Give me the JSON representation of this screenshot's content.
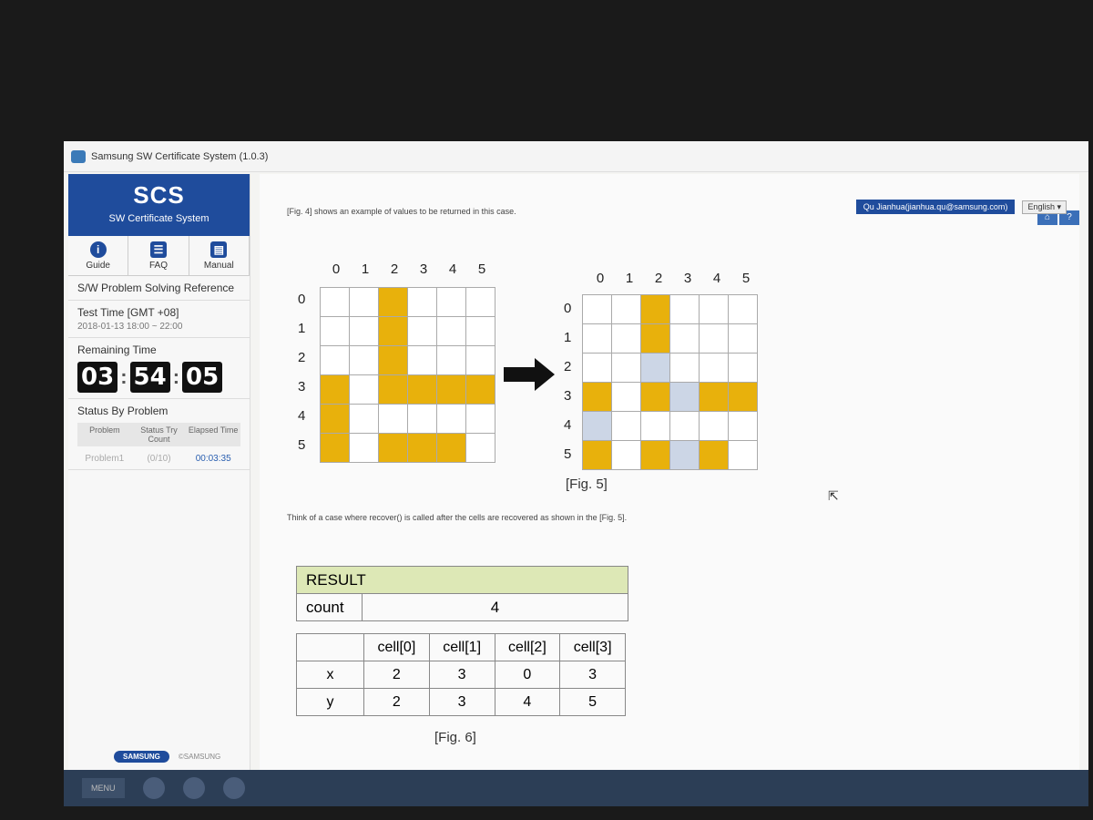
{
  "window": {
    "title": "Samsung SW Certificate System (1.0.3)"
  },
  "brand": {
    "name": "SCS",
    "subtitle": "SW Certificate System"
  },
  "iconbar": [
    {
      "label": "Guide",
      "icon": "info-icon"
    },
    {
      "label": "FAQ",
      "icon": "faq-icon"
    },
    {
      "label": "Manual",
      "icon": "manual-icon"
    }
  ],
  "sidebar": {
    "reference": "S/W Problem Solving Reference",
    "test_time_label": "Test Time [GMT +08]",
    "test_time_value": "2018-01-13 18:00 ~ 22:00",
    "remaining_label": "Remaining Time",
    "timer": {
      "h": "03",
      "m": "54",
      "s": "05"
    },
    "status_label": "Status By Problem",
    "status_headers": [
      "Problem",
      "Status Try Count",
      "Elapsed Time"
    ],
    "status_row": {
      "problem": "Problem1",
      "count": "(0/10)",
      "time": "00:03:35"
    }
  },
  "footer": {
    "samsung": "SAMSUNG",
    "copyright": "©SAMSUNG"
  },
  "user": {
    "name": "Qu Jianhua(jianhua.qu@samsung.com)",
    "language": "English"
  },
  "content": {
    "intro": "[Fig. 4] shows an example of values to be returned in this case.",
    "fig5_caption": "[Fig. 5]",
    "think": "Think of a case where recover() is called after the cells are recovered as shown in the [Fig. 5].",
    "grid_cols": [
      "0",
      "1",
      "2",
      "3",
      "4",
      "5"
    ],
    "grid_rows": [
      "0",
      "1",
      "2",
      "3",
      "4",
      "5"
    ],
    "result": {
      "title": "RESULT",
      "count_label": "count",
      "count_value": "4"
    },
    "cells_header": [
      "cell[0]",
      "cell[1]",
      "cell[2]",
      "cell[3]"
    ],
    "x_label": "x",
    "y_label": "y",
    "x_values": [
      "2",
      "3",
      "0",
      "3"
    ],
    "y_values": [
      "2",
      "3",
      "4",
      "5"
    ],
    "fig6_caption": "[Fig. 6]"
  },
  "taskbar": {
    "menu": "MENU"
  },
  "colors": {
    "yellow": "#e8b10c",
    "recovered": "#ccd6e6",
    "brand": "#1f4c9c"
  }
}
